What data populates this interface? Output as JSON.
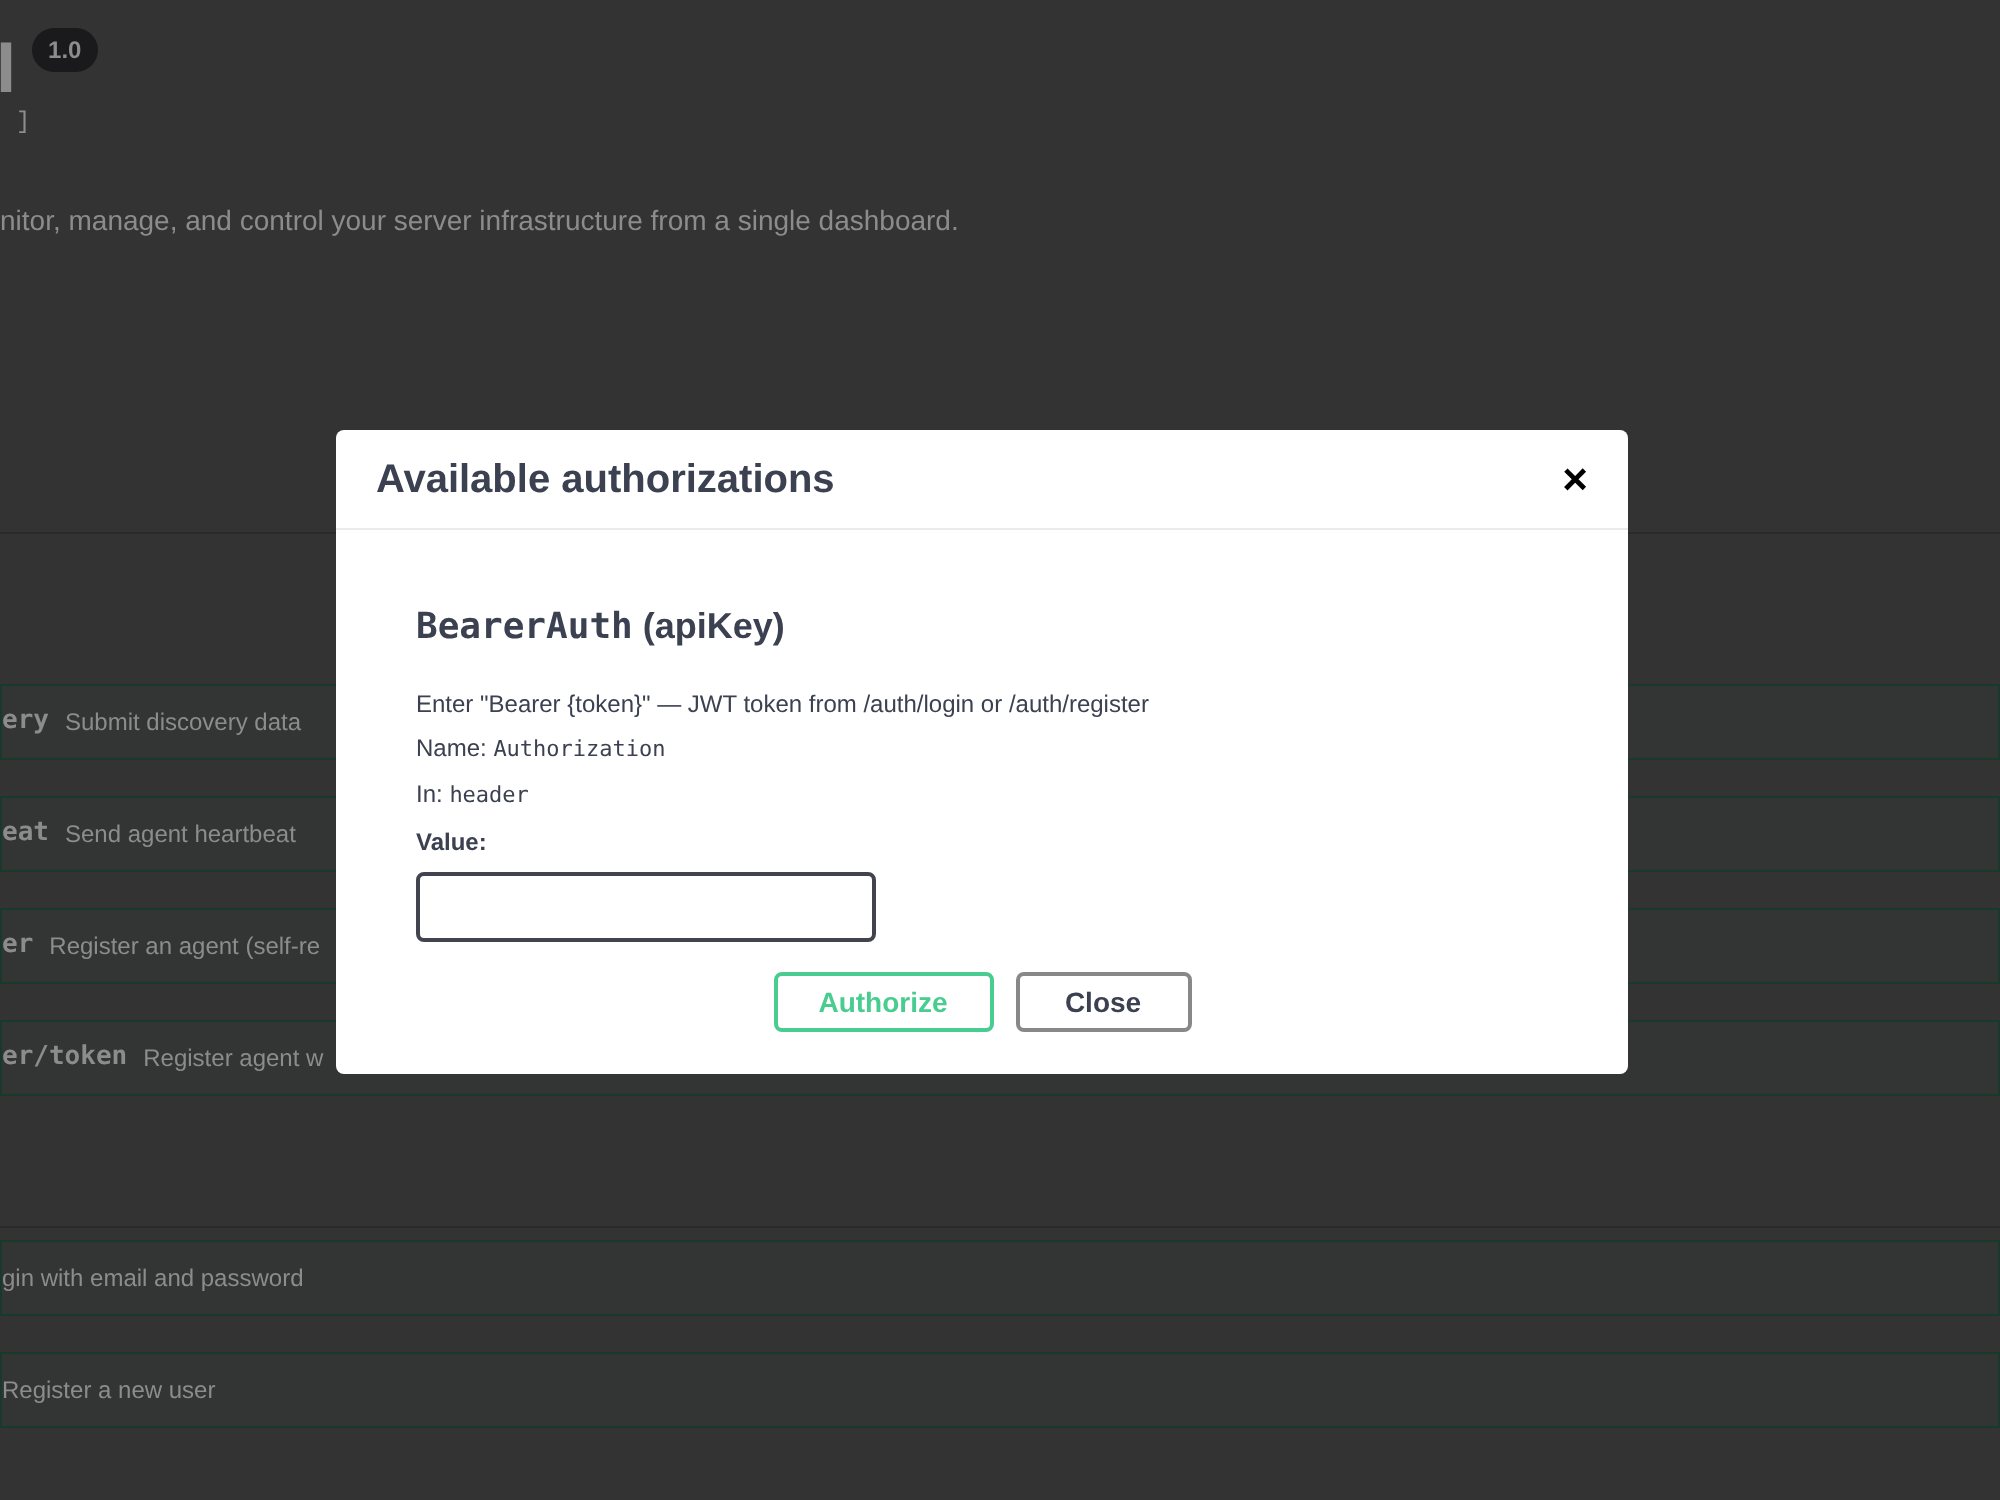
{
  "page": {
    "title": "I",
    "version": "1.0",
    "base_url": "]",
    "description": "nitor, manage, and control your server infrastructure from a single dashboard."
  },
  "sections": [
    {
      "operations": [
        {
          "path": "ery",
          "summary": "Submit discovery data"
        },
        {
          "path": "eat",
          "summary": "Send agent heartbeat"
        },
        {
          "path": "er",
          "summary": "Register an agent (self-re"
        },
        {
          "path": "er/token",
          "summary": "Register agent w"
        }
      ]
    },
    {
      "operations": [
        {
          "summary": "gin with email and password"
        },
        {
          "summary": "Register a new user"
        }
      ]
    }
  ],
  "dialog": {
    "title": "Available authorizations",
    "close_glyph": "×",
    "scheme_name": "BearerAuth",
    "scheme_type": "(apiKey)",
    "description": "Enter \"Bearer {token}\" — JWT token from /auth/login or /auth/register",
    "name_label": "Name:",
    "name_value": "Authorization",
    "in_label": "In:",
    "in_value": "header",
    "value_label": "Value:",
    "buttons": [
      {
        "kind": "authorize",
        "label": "Authorize"
      },
      {
        "kind": "close",
        "label": "Close"
      }
    ]
  }
}
